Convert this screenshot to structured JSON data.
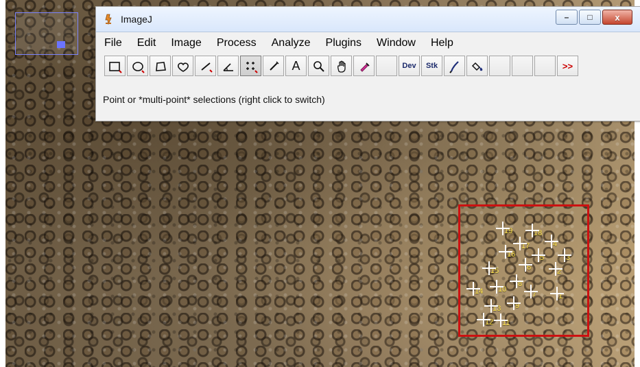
{
  "window": {
    "title": "ImageJ",
    "controls": {
      "minimize": "–",
      "maximize": "□",
      "close": "x"
    }
  },
  "menu": {
    "items": [
      "File",
      "Edit",
      "Image",
      "Process",
      "Analyze",
      "Plugins",
      "Window",
      "Help"
    ]
  },
  "toolbar": {
    "tools": [
      {
        "icon": "rectangle-selection-icon"
      },
      {
        "icon": "oval-selection-icon"
      },
      {
        "icon": "polygon-selection-icon"
      },
      {
        "icon": "freehand-selection-icon"
      },
      {
        "icon": "line-selection-icon"
      },
      {
        "icon": "angle-tool-icon"
      },
      {
        "icon": "multi-point-tool-icon",
        "selected": true
      },
      {
        "icon": "wand-tool-icon"
      },
      {
        "icon": "text-tool-icon",
        "label": "A"
      },
      {
        "icon": "zoom-tool-icon"
      },
      {
        "icon": "hand-tool-icon"
      },
      {
        "icon": "color-picker-icon"
      },
      {
        "icon": "blank-slot-icon"
      },
      {
        "icon": "dev-tool-icon",
        "label": "Dev"
      },
      {
        "icon": "stk-tool-icon",
        "label": "Stk"
      },
      {
        "icon": "brush-tool-icon"
      },
      {
        "icon": "flood-fill-tool-icon"
      },
      {
        "icon": "blank-slot-icon"
      },
      {
        "icon": "blank-slot-icon"
      },
      {
        "icon": "blank-slot-icon"
      },
      {
        "icon": "more-tools-icon",
        "label": ">>"
      }
    ]
  },
  "status": {
    "text": "Point or *multi-point* selections (right click to switch)"
  },
  "image": {
    "thumbnail_present": true,
    "roi_box_color": "#cc1111",
    "points_color": "#ffffff",
    "labels_color": "#ffe44a",
    "point_labels": [
      "19",
      "18",
      "4",
      "17",
      "3",
      "16",
      "5",
      "6",
      "15",
      "2",
      "8",
      "14",
      "10",
      "7",
      "1",
      "9",
      "13",
      "12",
      "11"
    ]
  }
}
